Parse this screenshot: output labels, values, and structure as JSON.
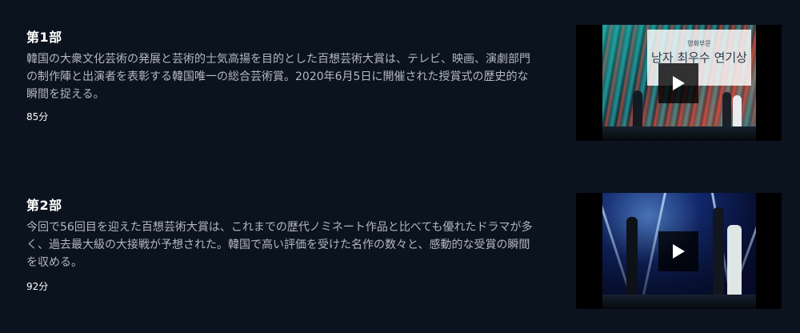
{
  "episodes": [
    {
      "title": "第1部",
      "description": "韓国の大衆文化芸術の発展と芸術的士気高揚を目的とした百想芸術大賞は、テレビ、映画、演劇部門の制作陣と出演者を表彰する韓国唯一の総合芸術賞。2020年6月5日に開催された授賞式の歴史的な瞬間を捉える。",
      "duration": "85分",
      "thumbnail": {
        "banner_small": "영화부문",
        "banner_large": "남자 최우수 연기상"
      },
      "play_icon": "play-icon"
    },
    {
      "title": "第2部",
      "description": "今回で56回目を迎えた百想芸術大賞は、これまでの歴代ノミネート作品と比べても優れたドラマが多く、過去最大級の大接戦が予想された。韓国で高い評価を受けた名作の数々と、感動的な受賞の瞬間を収める。",
      "duration": "92分",
      "play_icon": "play-icon"
    }
  ],
  "colors": {
    "background": "#0b131f",
    "title": "#ffffff",
    "description": "#b3b8c0"
  }
}
